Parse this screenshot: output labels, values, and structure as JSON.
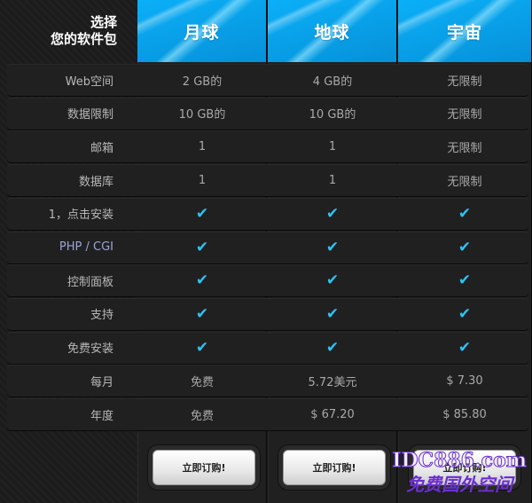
{
  "sidebar": {
    "title_line1": "选择",
    "title_line2": "您的软件包"
  },
  "plans": [
    {
      "name": "月球",
      "buy_label": "立即订购!"
    },
    {
      "name": "地球",
      "buy_label": "立即订购!"
    },
    {
      "name": "宇宙",
      "buy_label": "立即订购!"
    }
  ],
  "rows": [
    {
      "label": "Web空间",
      "values": [
        "2 GB的",
        "4 GB的",
        "无限制"
      ]
    },
    {
      "label": "数据限制",
      "values": [
        "10 GB的",
        "10 GB的",
        "无限制"
      ]
    },
    {
      "label": "邮箱",
      "values": [
        "1",
        "1",
        "无限制"
      ]
    },
    {
      "label": "数据库",
      "values": [
        "1",
        "1",
        "无限制"
      ]
    },
    {
      "label": "1，点击安装",
      "values": [
        "✔",
        "✔",
        "✔"
      ]
    },
    {
      "label": "PHP / CGI",
      "values": [
        "✔",
        "✔",
        "✔"
      ]
    },
    {
      "label": "控制面板",
      "values": [
        "✔",
        "✔",
        "✔"
      ]
    },
    {
      "label": "支持",
      "values": [
        "✔",
        "✔",
        "✔"
      ]
    },
    {
      "label": "免费安装",
      "values": [
        "✔",
        "✔",
        "✔"
      ]
    },
    {
      "label": "每月",
      "values": [
        "免费",
        "5.72美元",
        "$ 7.30"
      ]
    },
    {
      "label": "年度",
      "values": [
        "免费",
        "$ 67.20",
        "$ 85.80"
      ]
    }
  ],
  "watermark": {
    "line1": "IDC886.com",
    "line2": "免费国外空间"
  },
  "colors": {
    "accent": "#0aaaf0",
    "check": "#2fc1f2"
  }
}
